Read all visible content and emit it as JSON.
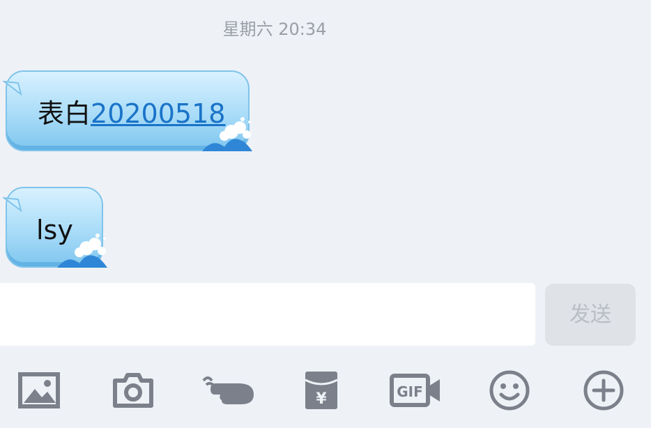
{
  "chat": {
    "timestamp": "星期六 20:34",
    "messages": [
      {
        "prefix": "表白",
        "link": "20200518"
      },
      {
        "text": "lsy"
      }
    ]
  },
  "composer": {
    "value": "",
    "placeholder": "",
    "send_label": "发送"
  },
  "toolbar": {
    "items": [
      {
        "icon": "image-icon"
      },
      {
        "icon": "camera-icon"
      },
      {
        "icon": "poke-hand-icon"
      },
      {
        "icon": "red-packet-icon",
        "symbol": "¥"
      },
      {
        "icon": "gif-video-icon",
        "label": "GIF"
      },
      {
        "icon": "emoji-icon"
      },
      {
        "icon": "plus-icon"
      }
    ]
  },
  "colors": {
    "background": "#eef1f6",
    "bubble": "#a9dcf8",
    "link": "#1a73c8",
    "icon": "#7b808a",
    "send_disabled": "#dfe2e7"
  }
}
